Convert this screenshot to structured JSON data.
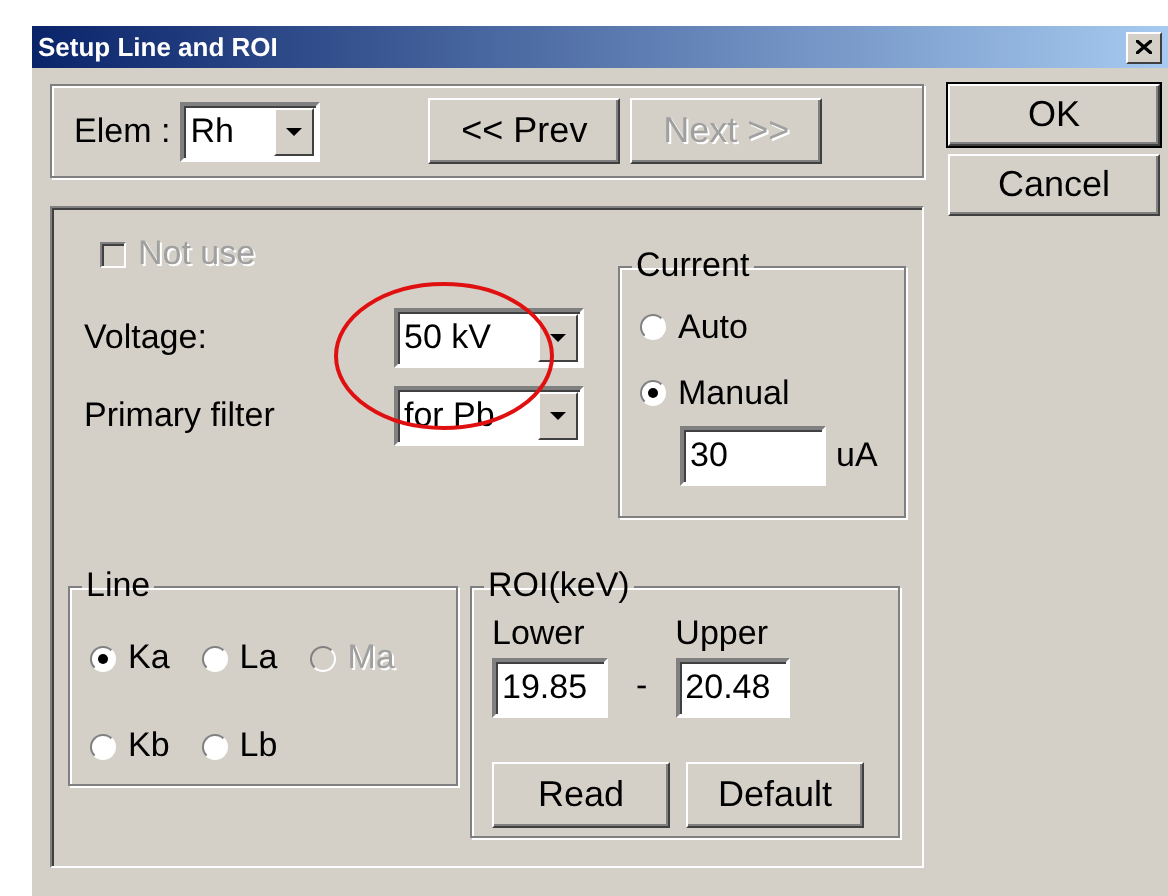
{
  "window": {
    "title": "Setup Line and ROI"
  },
  "element": {
    "label": "Elem :",
    "value": "Rh"
  },
  "nav": [
    {
      "label": "<< Prev",
      "disabled": false
    },
    {
      "label": "Next >>",
      "disabled": true
    }
  ],
  "dialog_buttons": [
    {
      "label": "OK",
      "default": true
    },
    {
      "label": "Cancel",
      "default": false
    }
  ],
  "not_use": {
    "label": "Not use",
    "checked": false,
    "disabled": true
  },
  "settings": [
    {
      "label": "Voltage:",
      "value": "50 kV"
    },
    {
      "label": "Primary filter",
      "value": "for Pb"
    }
  ],
  "current": {
    "title": "Current",
    "options": [
      {
        "label": "Auto",
        "selected": false
      },
      {
        "label": "Manual",
        "selected": true
      }
    ],
    "value": "30",
    "unit": "uA"
  },
  "line": {
    "title": "Line",
    "rows": [
      {
        "options": [
          {
            "label": "Ka",
            "selected": true,
            "disabled": false
          },
          {
            "label": "La",
            "selected": false,
            "disabled": false
          },
          {
            "label": "Ma",
            "selected": false,
            "disabled": true
          }
        ]
      },
      {
        "options": [
          {
            "label": "Kb",
            "selected": false,
            "disabled": false
          },
          {
            "label": "Lb",
            "selected": false,
            "disabled": false
          }
        ]
      }
    ]
  },
  "roi": {
    "title": "ROI(keV)",
    "lower": {
      "label": "Lower",
      "value": "19.85"
    },
    "separator": "-",
    "upper": {
      "label": "Upper",
      "value": "20.48"
    },
    "buttons": [
      {
        "label": "Read"
      },
      {
        "label": "Default"
      }
    ]
  }
}
